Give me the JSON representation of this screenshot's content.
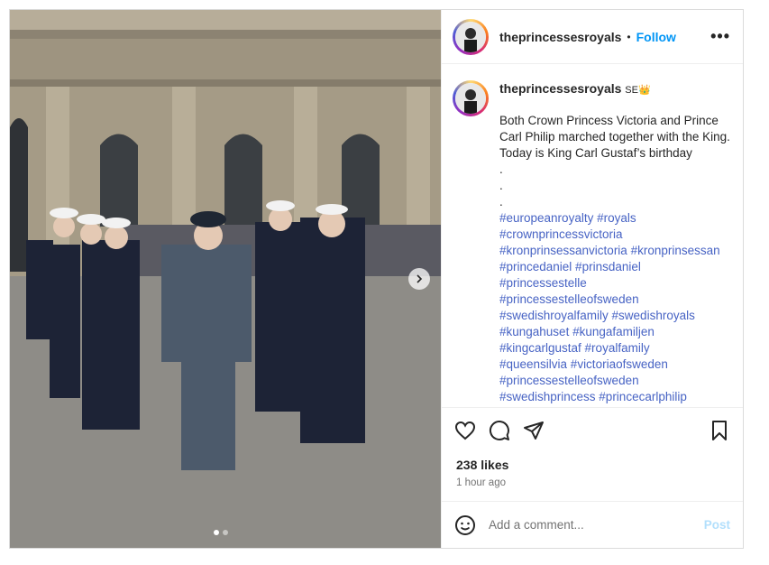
{
  "post": {
    "username": "theprincessesroyals",
    "separator": "•",
    "follow_label": "Follow",
    "more_label": "•••",
    "caption_username": "theprincessesroyals",
    "caption_flag": "SE👑",
    "caption": "Both Crown Princess Victoria and Prince Carl Philip marched together with the King. Today is King Carl Gustaf’s birthday\n.\n.\n.",
    "hashtags": [
      "#europeanroyalty #royals",
      "#crownprincessvictoria",
      "#kronprinsessanvictoria #kronprinsessan",
      "#princedaniel #prinsdaniel",
      "#princessestelle",
      "#princessestelleofsweden",
      "#swedishroyalfamily #swedishroyals",
      "#kungahuset #kungafamiljen",
      "#kingcarlgustaf #royalfamily",
      "#queensilvia #victoriaofsweden",
      "#princessestelleofsweden",
      "#swedishprincess #princecarlphilip"
    ],
    "likes": "238 likes",
    "time": "1 hour ago",
    "comment_placeholder": "Add a comment...",
    "post_label": "Post"
  },
  "icons": {
    "like": "heart-icon",
    "comment": "comment-icon",
    "share": "paper-plane-icon",
    "save": "bookmark-icon",
    "emoji": "emoji-icon",
    "next": "chevron-right-icon"
  },
  "colors": {
    "follow": "#0095f6",
    "hashtag": "#4763c4",
    "post_disabled": "#b2dffc"
  },
  "carousel": {
    "slide_count": 2,
    "active_index": 0
  }
}
